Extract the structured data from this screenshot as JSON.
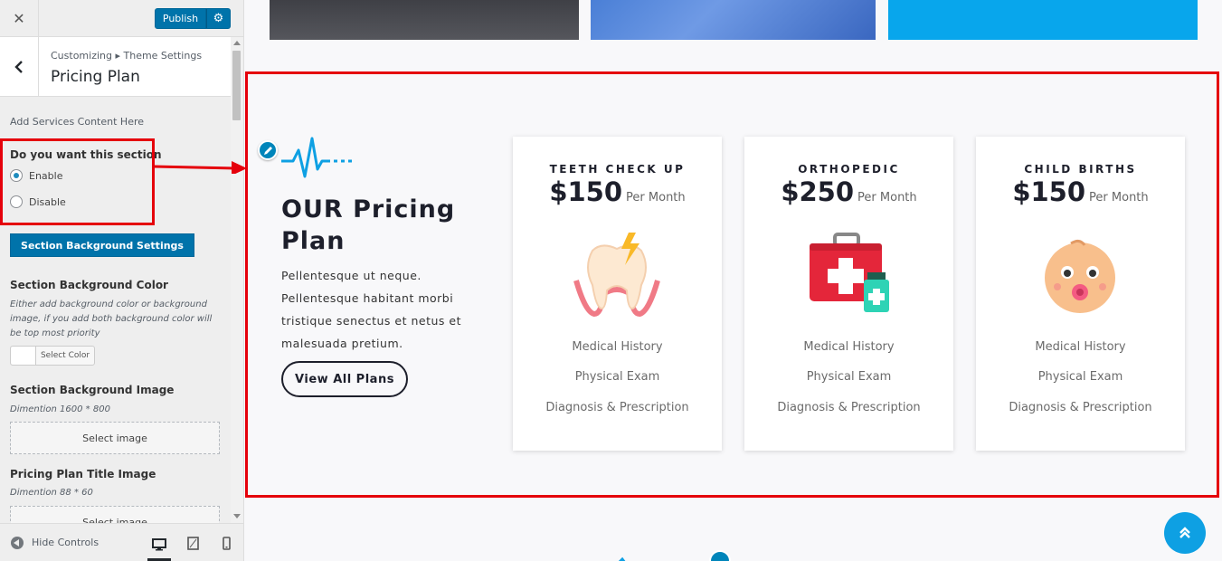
{
  "sidebar": {
    "close_label": "✕",
    "publish_label": "Publish",
    "breadcrumb": "Customizing ▸ Theme Settings",
    "panel_title": "Pricing Plan",
    "add_services_note": "Add Services Content Here",
    "section_toggle": {
      "label": "Do you want this section",
      "options": [
        "Enable",
        "Disable"
      ],
      "selected": "Enable"
    },
    "bg_settings_button": "Section Background Settings",
    "bg_color": {
      "label": "Section Background Color",
      "note": "Either add background color or background image, if you add both background color will be top most priority",
      "button": "Select Color"
    },
    "bg_image": {
      "label": "Section Background Image",
      "dimension": "Dimention 1600 * 800",
      "button": "Select image"
    },
    "title_image": {
      "label": "Pricing Plan Title Image",
      "dimension": "Dimention 88 * 60",
      "button": "Select image"
    },
    "hide_controls": "Hide Controls"
  },
  "preview": {
    "heading": "OUR Pricing Plan",
    "text": "Pellentesque ut neque. Pellentesque habitant morbi tristique senectus et netus et malesuada pretium.",
    "cta": "View All Plans",
    "accent": "#0ea0e3",
    "highlight_color": "#e5000b",
    "cards": [
      {
        "title": "TEETH CHECK UP",
        "price": "$150",
        "per": "Per Month",
        "icon": "tooth-icon",
        "features": [
          "Medical History",
          "Physical Exam",
          "Diagnosis & Prescription"
        ]
      },
      {
        "title": "ORTHOPEDIC",
        "price": "$250",
        "per": "Per Month",
        "icon": "first-aid-kit-icon",
        "features": [
          "Medical History",
          "Physical Exam",
          "Diagnosis & Prescription"
        ]
      },
      {
        "title": "CHILD BIRTHS",
        "price": "$150",
        "per": "Per Month",
        "icon": "baby-face-icon",
        "features": [
          "Medical History",
          "Physical Exam",
          "Diagnosis & Prescription"
        ]
      }
    ]
  }
}
